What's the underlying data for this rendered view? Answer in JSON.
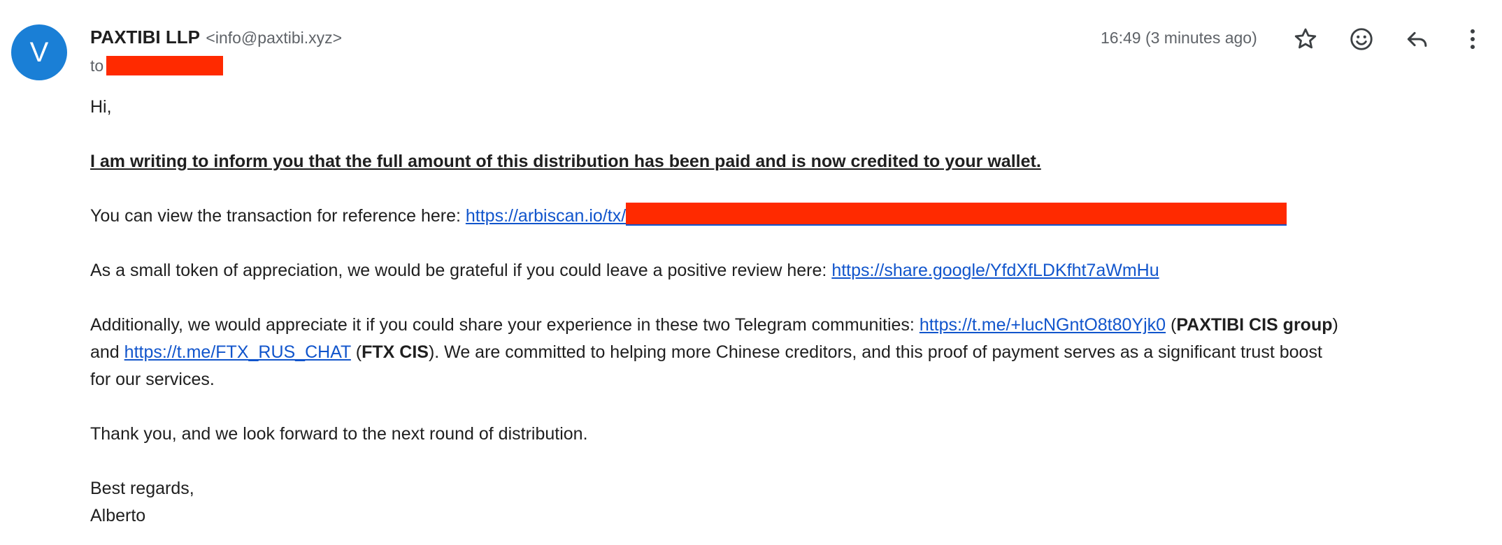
{
  "avatar": {
    "letter": "V",
    "color": "#1a7fd6"
  },
  "sender": {
    "name": "PAXTIBI LLP",
    "email": "<info@paxtibi.xyz>"
  },
  "recipient": {
    "label": "to"
  },
  "timestamp": "16:49 (3 minutes ago)",
  "toolbar": {
    "icons": [
      "star-icon",
      "emoji-icon",
      "reply-icon",
      "more-vert-icon"
    ]
  },
  "redaction_color": "#ff2a00",
  "body": {
    "greeting": "Hi,",
    "headline": "I am writing to inform you that the full amount of this distribution has been paid and is now credited to your wallet.",
    "tx_prefix": "You can view the transaction for reference here: ",
    "tx_link": "https://arbiscan.io/tx/",
    "review_prefix": "As a small token of appreciation, we would be grateful if you could leave a positive review here: ",
    "review_link": "https://share.google/YfdXfLDKfht7aWmHu",
    "telegram_prefix": "Additionally, we would appreciate it if you could share your experience in these two Telegram communities: ",
    "telegram_link1": "https://t.me/+lucNGntO8t80Yjk0",
    "open_paren1": " (",
    "group1_name": "PAXTIBI CIS group",
    "between_groups": ") and ",
    "telegram_link2": "https://t.me/FTX_RUS_CHAT",
    "open_paren2": " (",
    "group2_name": "FTX CIS",
    "telegram_suffix": "). We are committed to helping more Chinese creditors, and this proof of payment serves as a significant trust boost for our services.",
    "thanks": "Thank you, and we look forward to the next round of distribution.",
    "closing": "Best regards,",
    "signature": "Alberto"
  }
}
